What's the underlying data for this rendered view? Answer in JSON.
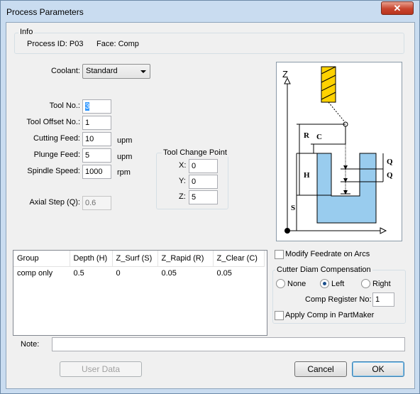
{
  "window": {
    "title": "Process Parameters",
    "close_label": "✕"
  },
  "info": {
    "group_title": "Info",
    "process_id": "Process ID: P03",
    "face": "Face: Comp"
  },
  "coolant": {
    "label": "Coolant:",
    "value": "Standard"
  },
  "tool": {
    "tool_no_label": "Tool No.:",
    "tool_no": "3",
    "offset_label": "Tool Offset No.:",
    "offset": "1",
    "cutting_feed_label": "Cutting Feed:",
    "cutting_feed": "10",
    "cutting_feed_unit": "upm",
    "plunge_feed_label": "Plunge Feed:",
    "plunge_feed": "5",
    "plunge_feed_unit": "upm",
    "spindle_label": "Spindle Speed:",
    "spindle": "1000",
    "spindle_unit": "rpm",
    "axial_label": "Axial Step (Q):",
    "axial": "0.6"
  },
  "tool_change": {
    "title": "Tool Change Point",
    "x_label": "X:",
    "x": "0",
    "y_label": "Y:",
    "y": "0",
    "z_label": "Z:",
    "z": "5"
  },
  "diagram": {
    "z_axis": "Z",
    "R": "R",
    "C": "C",
    "H": "H",
    "S": "S",
    "Q1": "Q",
    "Q2": "Q"
  },
  "table": {
    "headers": [
      "Group",
      "Depth (H)",
      "Z_Surf (S)",
      "Z_Rapid (R)",
      "Z_Clear (C)"
    ],
    "rows": [
      [
        "comp only",
        "0.5",
        "0",
        "0.05",
        "0.05"
      ]
    ]
  },
  "modify_feedrate": {
    "label": "Modify Feedrate on Arcs",
    "checked": false
  },
  "cutter_comp": {
    "title": "Cutter Diam Compensation",
    "none": "None",
    "left": "Left",
    "right": "Right",
    "selected": "Left",
    "register_label": "Comp Register No:",
    "register": "1",
    "apply_label": "Apply Comp in PartMaker",
    "apply_checked": false
  },
  "note": {
    "label": "Note:",
    "value": ""
  },
  "buttons": {
    "user_data": "User Data",
    "cancel": "Cancel",
    "ok": "OK"
  }
}
